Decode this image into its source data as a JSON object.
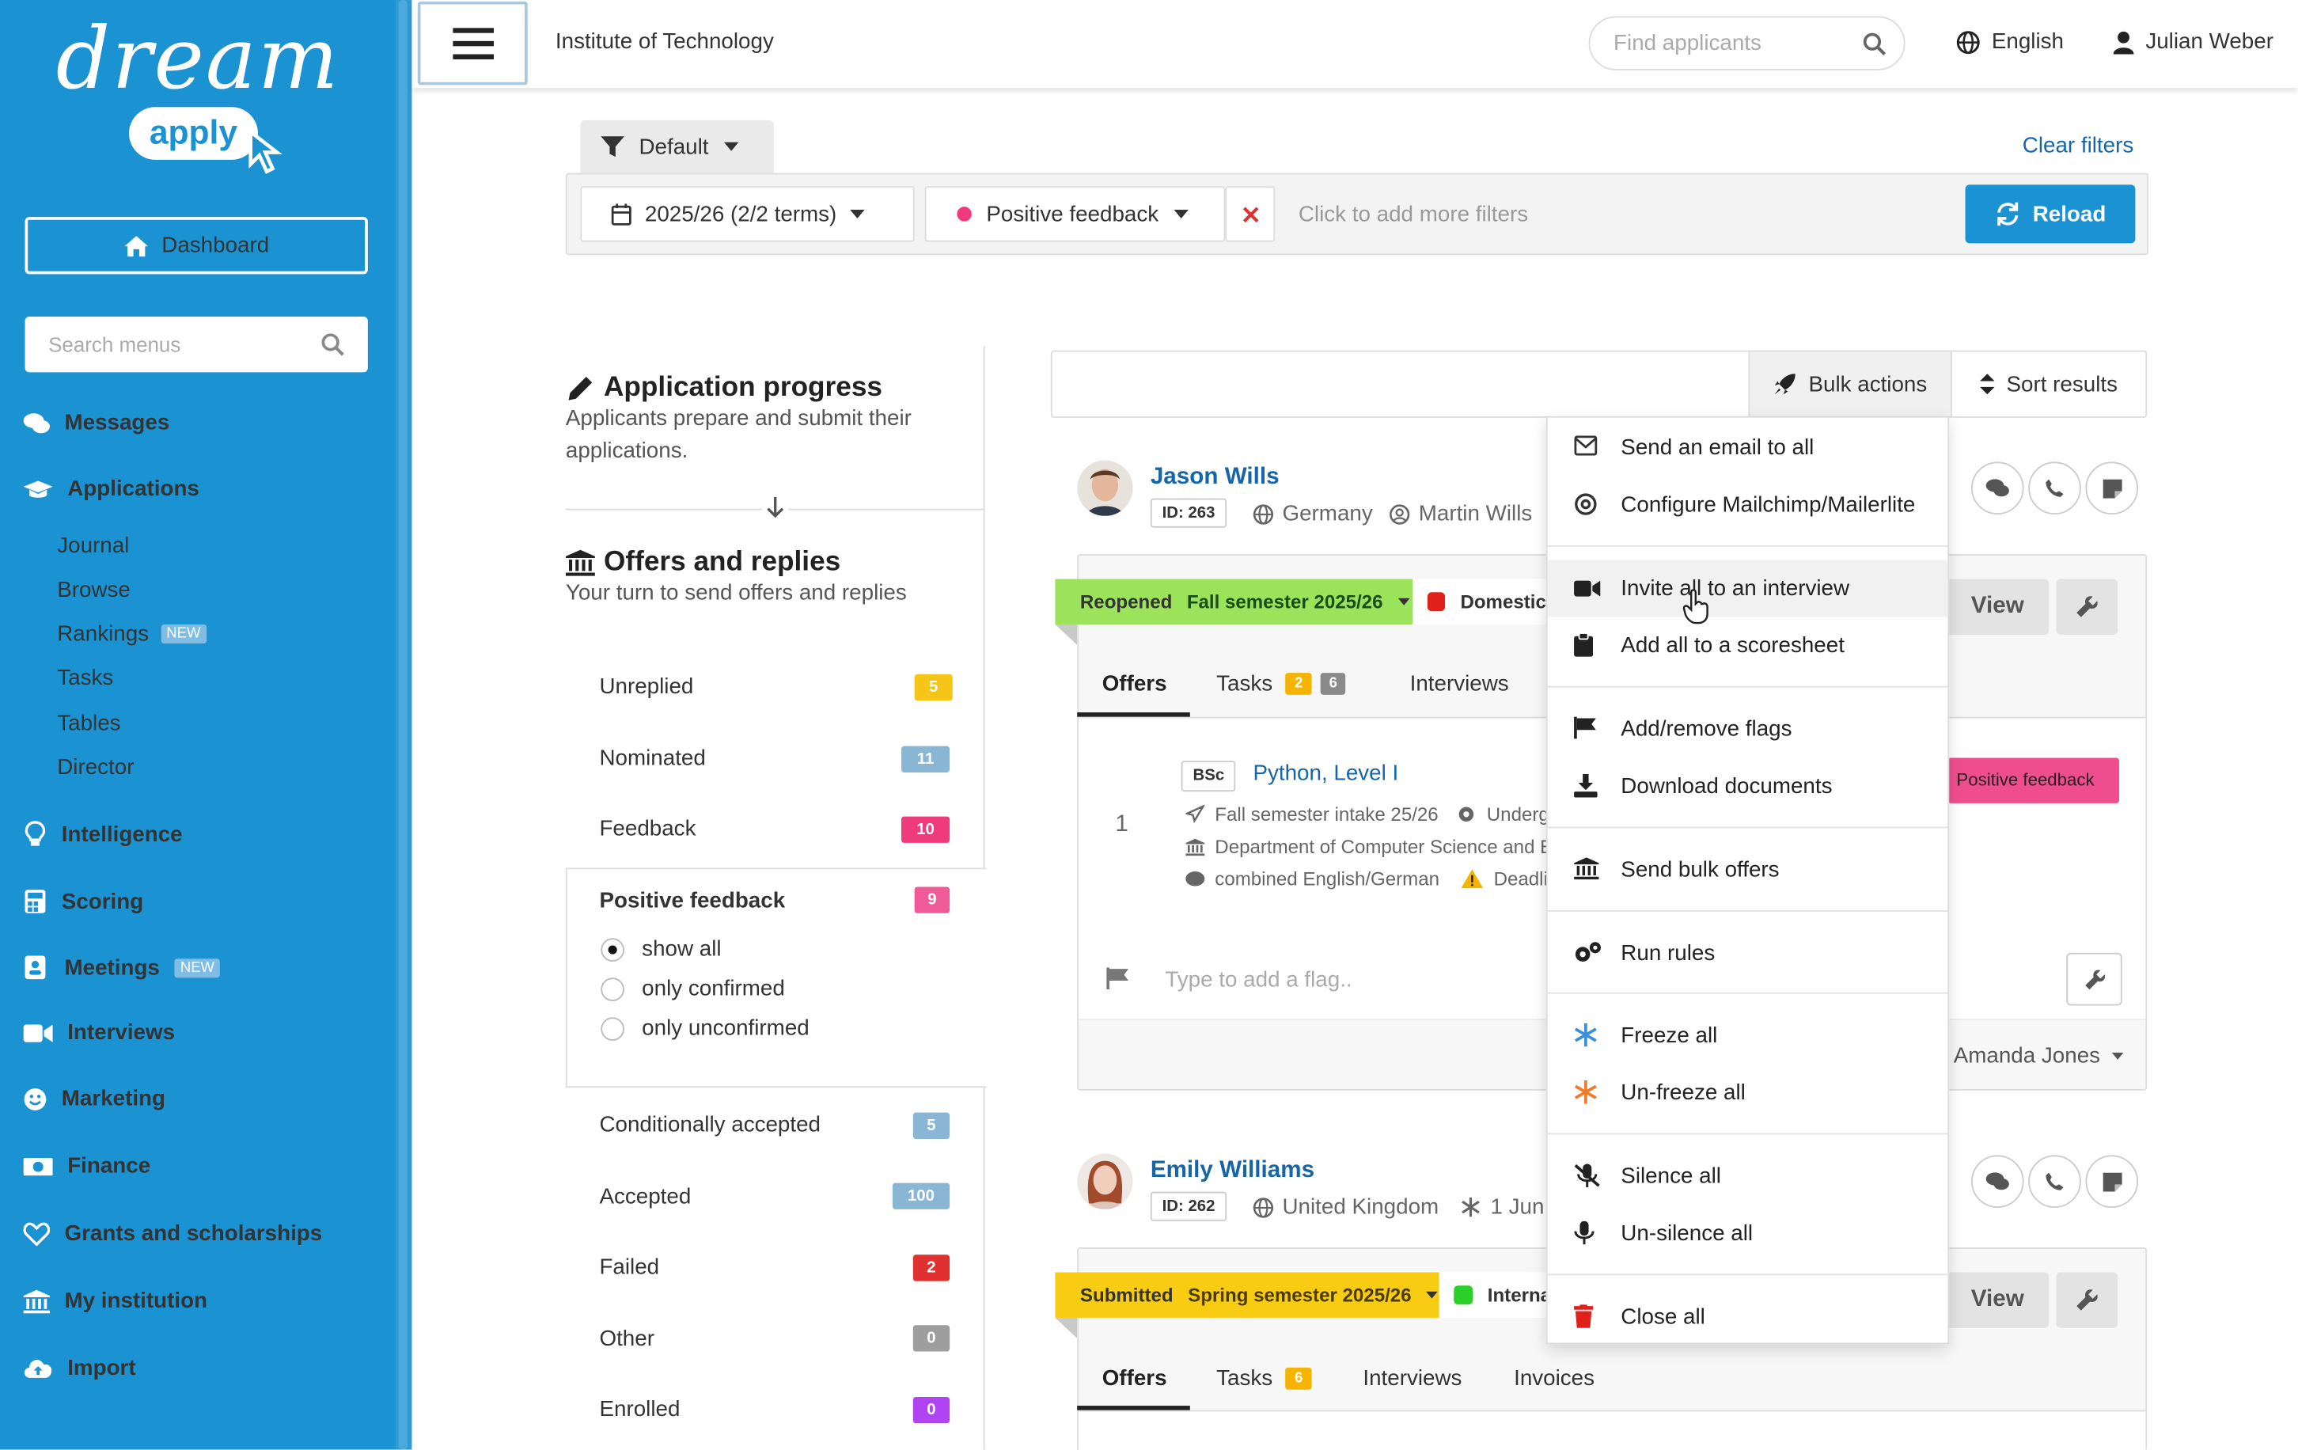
{
  "brand": {
    "logo_dream": "dream",
    "logo_apply": "apply"
  },
  "sidebar": {
    "dashboard": "Dashboard",
    "search_placeholder": "Search menus",
    "items": [
      {
        "label": "Messages"
      },
      {
        "label": "Applications",
        "children": [
          {
            "label": "Journal"
          },
          {
            "label": "Browse"
          },
          {
            "label": "Rankings",
            "badge": "NEW"
          },
          {
            "label": "Tasks"
          },
          {
            "label": "Tables"
          },
          {
            "label": "Director"
          }
        ]
      },
      {
        "label": "Intelligence"
      },
      {
        "label": "Scoring"
      },
      {
        "label": "Meetings",
        "badge": "NEW"
      },
      {
        "label": "Interviews"
      },
      {
        "label": "Marketing"
      },
      {
        "label": "Finance"
      },
      {
        "label": "Grants and scholarships"
      },
      {
        "label": "My institution"
      },
      {
        "label": "Import"
      }
    ]
  },
  "topbar": {
    "institution": "Institute of Technology",
    "search_placeholder": "Find applicants",
    "language": "English",
    "user": "Julian Weber"
  },
  "filters": {
    "preset": "Default",
    "clear": "Clear filters",
    "term": "2025/26 (2/2 terms)",
    "status": "Positive feedback",
    "add_placeholder": "Click to add more filters",
    "reload": "Reload"
  },
  "progress": {
    "app_title": "Application progress",
    "app_desc": "Applicants prepare and submit their applications.",
    "offers_title": "Offers and replies",
    "offers_desc": "Your turn to send offers and replies",
    "statuses": [
      {
        "label": "Unreplied",
        "count": "5",
        "color": "#f5c518"
      },
      {
        "label": "Nominated",
        "count": "11",
        "color": "#8ab6d6"
      },
      {
        "label": "Feedback",
        "count": "10",
        "color": "#ef3b7b"
      },
      {
        "label": "Positive feedback",
        "count": "9",
        "color": "#ef5b98"
      },
      {
        "label": "Conditionally accepted",
        "count": "5",
        "color": "#8ab6d6"
      },
      {
        "label": "Accepted",
        "count": "100",
        "color": "#8ab6d6"
      },
      {
        "label": "Failed",
        "count": "2",
        "color": "#e03131"
      },
      {
        "label": "Other",
        "count": "0",
        "color": "#9e9e9e"
      },
      {
        "label": "Enrolled",
        "count": "0",
        "color": "#b044f2"
      }
    ],
    "radios": [
      {
        "label": "show all",
        "checked": true
      },
      {
        "label": "only confirmed"
      },
      {
        "label": "only unconfirmed"
      }
    ]
  },
  "toolbar": {
    "bulk": "Bulk actions",
    "sort": "Sort results"
  },
  "applicants": [
    {
      "name": "Jason Wills",
      "id": "ID: 263",
      "country": "Germany",
      "agent": "Martin Wills",
      "ribbon_status": "Reopened",
      "ribbon_term": "Fall semester 2025/26",
      "ribbon_color": "#9be35a",
      "residency": "Domestic",
      "residency_color": "#e0201a",
      "tabs": [
        {
          "label": "Offers"
        },
        {
          "label": "Tasks",
          "c1": "2",
          "c2": "6"
        },
        {
          "label": "Interviews"
        }
      ],
      "offer": {
        "num": "1",
        "degree": "BSc",
        "programme": "Python, Level I",
        "intake": "Fall semester intake 25/26",
        "level": "Underg",
        "dept": "Department of Computer Science and E",
        "lang": "combined English/German",
        "deadline": "Deadlin",
        "tag": "Positive feedback"
      },
      "flag_placeholder": "Type to add a flag..",
      "assignee": "Amanda Jones",
      "view": "View"
    },
    {
      "name": "Emily Williams",
      "id": "ID: 262",
      "country": "United Kingdom",
      "extra": "1 Jun",
      "ribbon_status": "Submitted",
      "ribbon_term": "Spring semester 2025/26",
      "ribbon_color": "#f9cc14",
      "residency": "Interna",
      "residency_color": "#2bd02b",
      "tabs": [
        {
          "label": "Offers"
        },
        {
          "label": "Tasks",
          "c1": "6"
        },
        {
          "label": "Interviews"
        },
        {
          "label": "Invoices"
        }
      ],
      "view": "View"
    }
  ],
  "bulk_menu": [
    "Send an email to all",
    "Configure Mailchimp/Mailerlite",
    "Invite all to an interview",
    "Add all to a scoresheet",
    "Add/remove flags",
    "Download documents",
    "Send bulk offers",
    "Run rules",
    "Freeze all",
    "Un-freeze all",
    "Silence all",
    "Un-silence all",
    "Close all"
  ],
  "colors": {
    "sidebar": "#1b92d2",
    "link": "#1565a8",
    "freeze": "#3b8fd8",
    "unfreeze": "#f07b2b",
    "close": "#e0201a"
  }
}
